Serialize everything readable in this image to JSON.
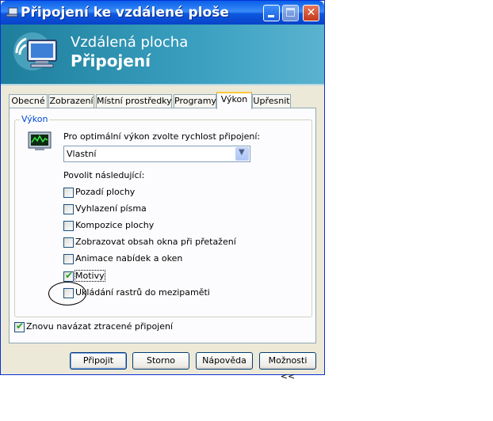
{
  "window": {
    "title": "Připojení ke vzdálené ploše",
    "controls": [
      "minimize",
      "maximize",
      "close"
    ]
  },
  "banner": {
    "line1": "Vzdálená plocha",
    "line2": "Připojení",
    "icon": "remote-desktop-icon"
  },
  "tabs": [
    {
      "label": "Obecné",
      "active": false
    },
    {
      "label": "Zobrazení",
      "active": false
    },
    {
      "label": "Místní prostředky",
      "active": false
    },
    {
      "label": "Programy",
      "active": false
    },
    {
      "label": "Výkon",
      "active": true
    },
    {
      "label": "Upřesnit",
      "active": false
    }
  ],
  "performance": {
    "legend": "Výkon",
    "prompt": "Pro optimální výkon zvolte rychlost připojení:",
    "speed_selected": "Vlastní",
    "allow_label": "Povolit následující:",
    "options": [
      {
        "label": "Pozadí plochy",
        "checked": false
      },
      {
        "label": "Vyhlazení písma",
        "checked": false
      },
      {
        "label": "Kompozice plochy",
        "checked": false
      },
      {
        "label": "Zobrazovat obsah okna při přetažení",
        "checked": false
      },
      {
        "label": "Animace nabídek a oken",
        "checked": false
      },
      {
        "label": "Motivy",
        "checked": true
      },
      {
        "label": "Ukládání rastrů do mezipaměti",
        "checked": false
      }
    ]
  },
  "reconnect": {
    "label": "Znovu navázat ztracené připojení",
    "checked": true
  },
  "buttons": {
    "connect": "Připojit",
    "cancel": "Storno",
    "help": "Nápověda",
    "options": "Možnosti <<"
  }
}
